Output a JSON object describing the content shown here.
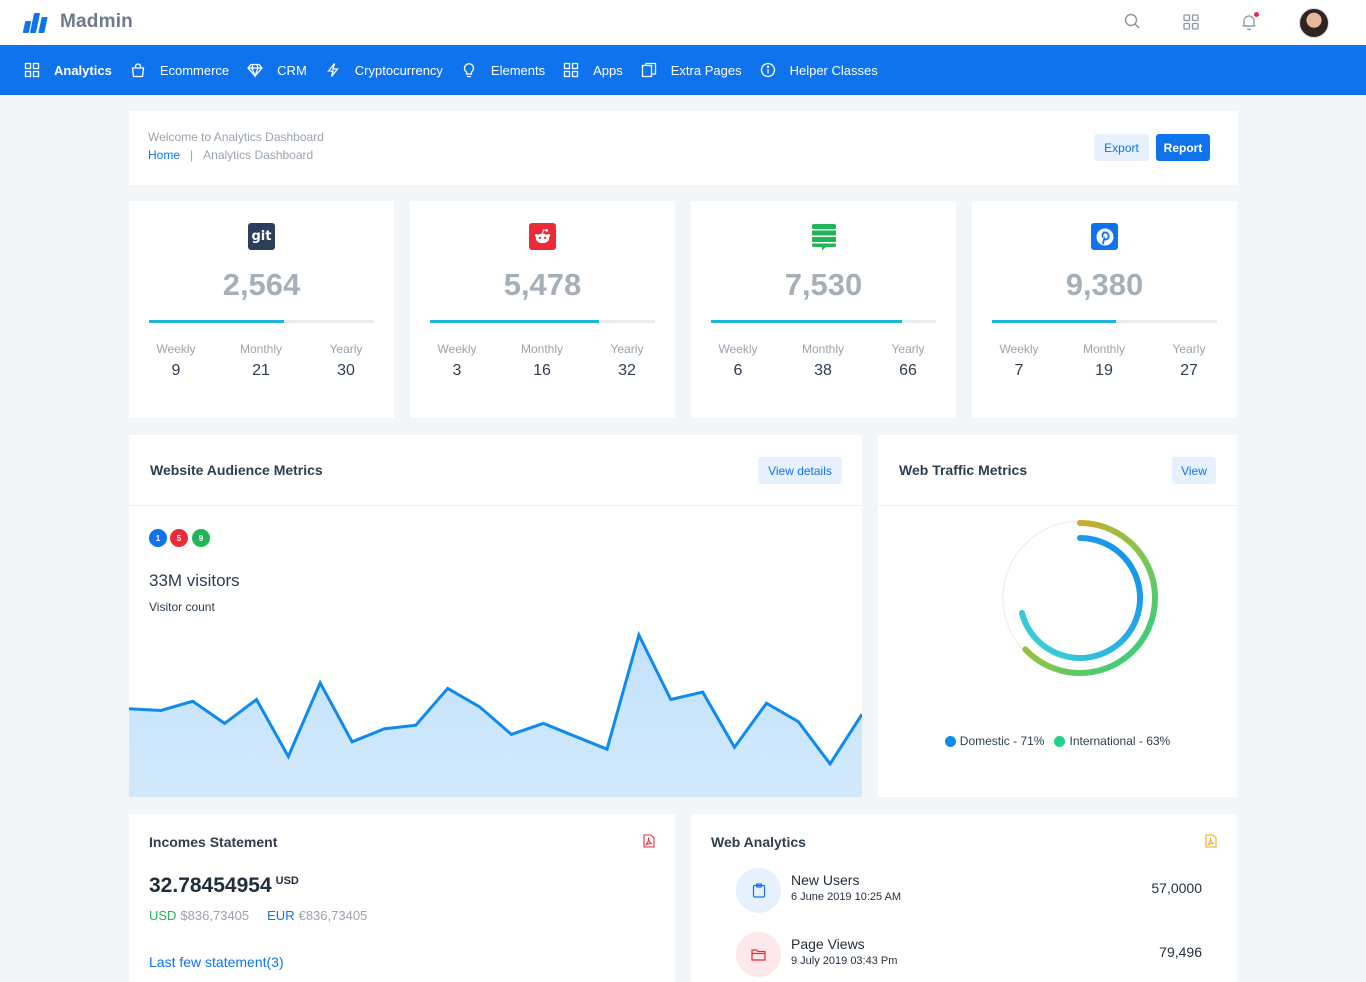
{
  "brand": {
    "name": "Madmin"
  },
  "nav": [
    {
      "label": "Analytics",
      "icon": "grid-icon"
    },
    {
      "label": "Ecommerce",
      "icon": "shopping-bag-icon"
    },
    {
      "label": "CRM",
      "icon": "diamond-icon"
    },
    {
      "label": "Cryptocurrency",
      "icon": "lightning-icon"
    },
    {
      "label": "Elements",
      "icon": "lightbulb-icon"
    },
    {
      "label": "Apps",
      "icon": "grid-icon"
    },
    {
      "label": "Extra Pages",
      "icon": "pages-icon"
    },
    {
      "label": "Helper Classes",
      "icon": "info-icon"
    }
  ],
  "header": {
    "welcome": "Welcome to Analytics Dashboard",
    "breadcrumb_home": "Home",
    "breadcrumb_sep": "|",
    "breadcrumb_current": "Analytics Dashboard",
    "export_label": "Export",
    "report_label": "Report"
  },
  "stats": [
    {
      "icon": "git-icon",
      "icon_text": "git",
      "color": "#2b3f5c",
      "value": "2,564",
      "progress": 0.6,
      "weekly": "9",
      "monthly": "21",
      "yearly": "30"
    },
    {
      "icon": "reddit-icon",
      "color": "#ec2b3a",
      "value": "5,478",
      "progress": 0.75,
      "weekly": "3",
      "monthly": "16",
      "yearly": "32"
    },
    {
      "icon": "stack-exchange-icon",
      "color": "#1fb755",
      "value": "7,530",
      "progress": 0.85,
      "weekly": "6",
      "monthly": "38",
      "yearly": "66"
    },
    {
      "icon": "pinterest-icon",
      "color": "#0f73ee",
      "value": "9,380",
      "progress": 0.55,
      "weekly": "7",
      "monthly": "19",
      "yearly": "27"
    }
  ],
  "labels": {
    "weekly": "Weekly",
    "monthly": "Monthly",
    "yearly": "Yearly"
  },
  "audience": {
    "title": "Website Audience Metrics",
    "view_details": "View details",
    "badges": [
      {
        "text": "1",
        "color": "#0f73ee"
      },
      {
        "text": "5",
        "color": "#ec2b3a"
      },
      {
        "text": "9",
        "color": "#1fb755"
      }
    ],
    "visitors": "33M visitors",
    "visitor_count_label": "Visitor count"
  },
  "chart_data": {
    "type": "area",
    "values": [
      48,
      47,
      52,
      40,
      53,
      22,
      62,
      30,
      37,
      39,
      59,
      49,
      34,
      40,
      33,
      26,
      88,
      53,
      57,
      27,
      51,
      41,
      18,
      45
    ],
    "ylim": [
      0,
      100
    ],
    "color": "#0f8aef",
    "fill": "#bfe0fb"
  },
  "traffic": {
    "title": "Web Traffic Metrics",
    "view_label": "View",
    "series": [
      {
        "name": "Domestic - 71%",
        "value": 71,
        "color": "#0f8aef"
      },
      {
        "name": "International - 63%",
        "value": 63,
        "color": "#1ed38a"
      }
    ]
  },
  "incomes": {
    "title": "Incomes Statement",
    "pdf_icon": "pdf-icon",
    "amount": "32.78454954",
    "unit": "USD",
    "usd_key": "USD",
    "usd_val": "$836,73405",
    "eur_key": "EUR",
    "eur_val": "€836,73405",
    "link": "Last few statement(3)"
  },
  "web_analytics": {
    "title": "Web Analytics",
    "pdf_icon": "pdf-icon",
    "rows": [
      {
        "icon": "clipboard-icon",
        "name": "New Users",
        "date": "6 June 2019 10:25 AM",
        "value": "57,0000",
        "bg": "#e7f1fd",
        "fg": "#0f73ee"
      },
      {
        "icon": "folder-icon",
        "name": "Page Views",
        "date": "9 July 2019 03:43 Pm",
        "value": "79,496",
        "bg": "#fde8ec",
        "fg": "#ec2b3a"
      }
    ]
  }
}
